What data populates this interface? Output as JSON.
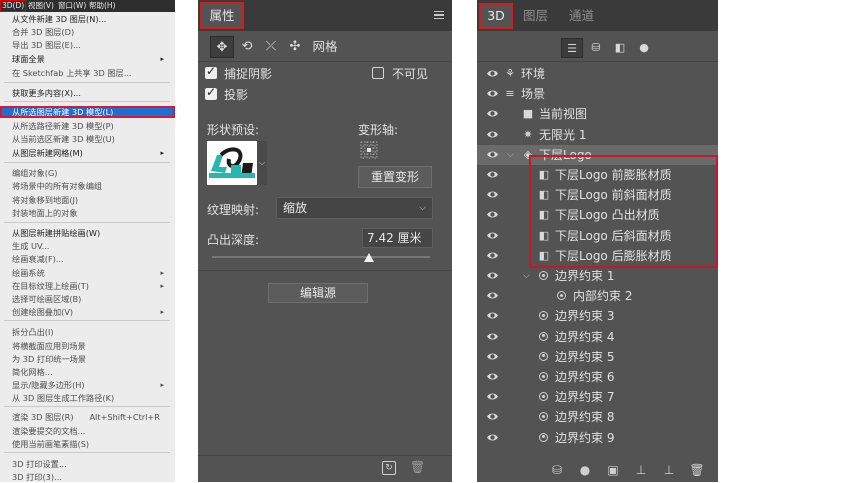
{
  "menubar": {
    "items": [
      "3D(D)",
      "视图(V)",
      "窗口(W)",
      "帮助(H)"
    ]
  },
  "menu": {
    "items": [
      {
        "label": "从文件新建 3D 图层(N)...",
        "dim": false
      },
      {
        "label": "合并 3D 图层(D)",
        "dim": true
      },
      {
        "label": "导出 3D 图层(E)...",
        "dim": true
      },
      {
        "label": "球面全景",
        "dim": false,
        "submenu": true
      },
      {
        "label": "在 Sketchfab 上共享 3D 图层...",
        "dim": true
      },
      {
        "label": "获取更多内容(X)...",
        "dim": false
      },
      {
        "label": "从所选图层新建 3D 模型(L)",
        "dim": false,
        "highlight": true
      },
      {
        "label": "从所选路径新建 3D 模型(P)",
        "dim": true
      },
      {
        "label": "从当前选区新建 3D 模型(U)",
        "dim": true
      },
      {
        "label": "从图层新建网格(M)",
        "dim": false,
        "submenu": true
      },
      {
        "label": "编组对象(G)",
        "dim": true
      },
      {
        "label": "将场景中的所有对象编组",
        "dim": true
      },
      {
        "label": "将对象移到地面(J)",
        "dim": true
      },
      {
        "label": "封装地面上的对象",
        "dim": true
      },
      {
        "label": "从图层新建拼贴绘画(W)",
        "dim": false
      },
      {
        "label": "生成 UV...",
        "dim": true
      },
      {
        "label": "绘画衰减(F)...",
        "dim": true
      },
      {
        "label": "绘画系统",
        "dim": true,
        "submenu": true
      },
      {
        "label": "在目标纹理上绘画(T)",
        "dim": true,
        "submenu": true
      },
      {
        "label": "选择可绘画区域(B)",
        "dim": true
      },
      {
        "label": "创建绘图叠加(V)",
        "dim": true,
        "submenu": true
      },
      {
        "label": "拆分凸出(I)",
        "dim": true
      },
      {
        "label": "将横截面应用到场景",
        "dim": true
      },
      {
        "label": "为 3D 打印统一场景",
        "dim": true
      },
      {
        "label": "简化网格...",
        "dim": true
      },
      {
        "label": "显示/隐藏多边形(H)",
        "dim": true,
        "submenu": true
      },
      {
        "label": "从 3D 图层生成工作路径(K)",
        "dim": true
      },
      {
        "label": "渲染 3D 图层(R)",
        "dim": true,
        "shortcut": "Alt+Shift+Ctrl+R"
      },
      {
        "label": "渲染要提交的文档...",
        "dim": true
      },
      {
        "label": "使用当前画笔素描(S)",
        "dim": true
      },
      {
        "label": "3D 打印设置...",
        "dim": true
      },
      {
        "label": "3D 打印(3)...",
        "dim": true
      }
    ]
  },
  "properties": {
    "tab_label": "属性",
    "tool_mesh_label": "网格",
    "catch_shadow_label": "捕捉阴影",
    "cast_shadow_label": "投影",
    "invisible_label": "不可见",
    "shape_preset_label": "形状预设:",
    "deform_axis_label": "变形轴:",
    "reset_deform_label": "重置变形",
    "texture_map_label": "纹理映射:",
    "texture_map_value": "缩放",
    "extrude_depth_label": "凸出深度:",
    "extrude_depth_value": "7.42 厘米",
    "extrude_depth_fraction": 0.72,
    "edit_source_label": "编辑源",
    "catch_shadow_checked": true,
    "cast_shadow_checked": true,
    "invisible_checked": false
  },
  "panel3d": {
    "tabs": [
      "3D",
      "图层",
      "通道"
    ],
    "tree": [
      {
        "label": "环境",
        "icon": "environment-icon",
        "indent": 0
      },
      {
        "label": "场景",
        "icon": "scene-icon",
        "indent": 0
      },
      {
        "label": "当前视图",
        "icon": "camera-icon",
        "indent": 1
      },
      {
        "label": "无限光 1",
        "icon": "light-icon",
        "indent": 1
      },
      {
        "label": "下层Logo",
        "icon": "mesh-icon",
        "indent": 1,
        "selected": true,
        "expanded": true
      },
      {
        "label": "下层Logo 前膨胀材质",
        "icon": "material-icon",
        "indent": 2
      },
      {
        "label": "下层Logo 前斜面材质",
        "icon": "material-icon",
        "indent": 2
      },
      {
        "label": "下层Logo 凸出材质",
        "icon": "material-icon",
        "indent": 2
      },
      {
        "label": "下层Logo 后斜面材质",
        "icon": "material-icon",
        "indent": 2
      },
      {
        "label": "下层Logo 后膨胀材质",
        "icon": "material-icon",
        "indent": 2
      },
      {
        "label": "边界约束 1",
        "icon": "constraint-icon",
        "indent": 2,
        "expanded": true
      },
      {
        "label": "内部约束 2",
        "icon": "constraint-icon",
        "indent": 3
      },
      {
        "label": "边界约束 3",
        "icon": "constraint-icon",
        "indent": 2
      },
      {
        "label": "边界约束 4",
        "icon": "constraint-icon",
        "indent": 2
      },
      {
        "label": "边界约束 5",
        "icon": "constraint-icon",
        "indent": 2
      },
      {
        "label": "边界约束 6",
        "icon": "constraint-icon",
        "indent": 2
      },
      {
        "label": "边界约束 7",
        "icon": "constraint-icon",
        "indent": 2
      },
      {
        "label": "边界约束 8",
        "icon": "constraint-icon",
        "indent": 2
      },
      {
        "label": "边界约束 9",
        "icon": "constraint-icon",
        "indent": 2
      }
    ]
  },
  "colors": {
    "menu_bg": "#ececec",
    "menu_highlight": "#1d6fd6",
    "panel_bg": "#535353",
    "panel_dark": "#3a3a3a",
    "annotation_red": "#d21d1d",
    "logo_teal": "#27b7b0"
  }
}
